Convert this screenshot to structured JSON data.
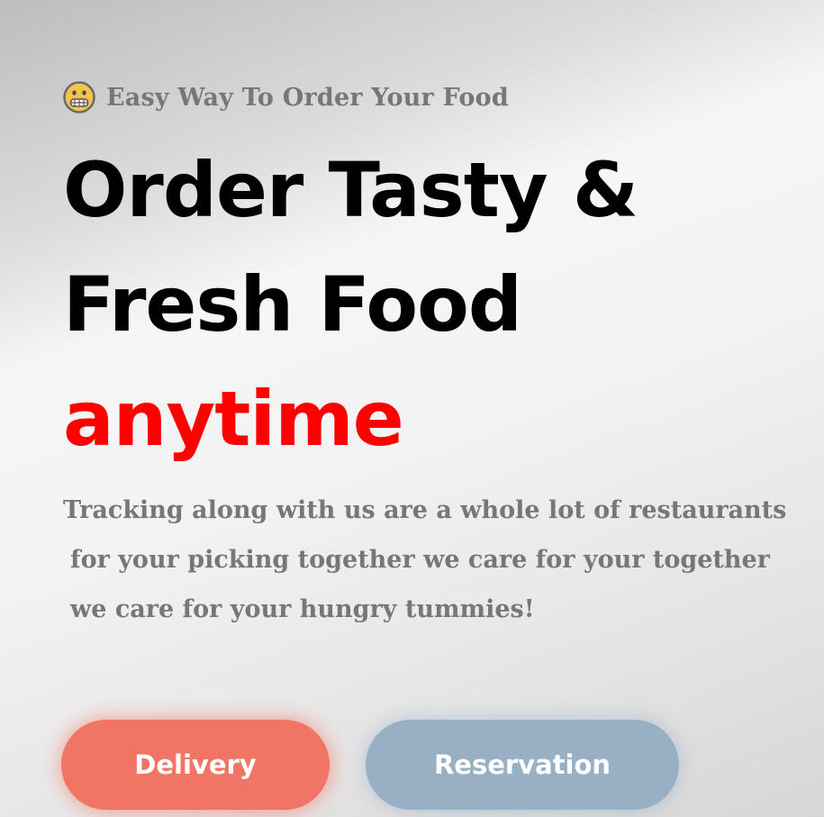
{
  "hero": {
    "tagline_icon": "grimacing-face-emoji",
    "tagline": "Easy Way To Order Your Food",
    "headline_line1": "Order Tasty &",
    "headline_line2": "Fresh Food",
    "headline_accent": "anytime",
    "description_lines": [
      "Tracking along with us are a whole lot of restaurants",
      "for your picking together we care for your together",
      "we care for your hungry tummies!"
    ]
  },
  "actions": {
    "delivery_label": "Delivery",
    "reservation_label": "Reservation"
  },
  "colors": {
    "accent": "#ff0000",
    "delivery_button": "#f07565",
    "reservation_button": "#98b0c4",
    "muted_text": "#777777"
  }
}
